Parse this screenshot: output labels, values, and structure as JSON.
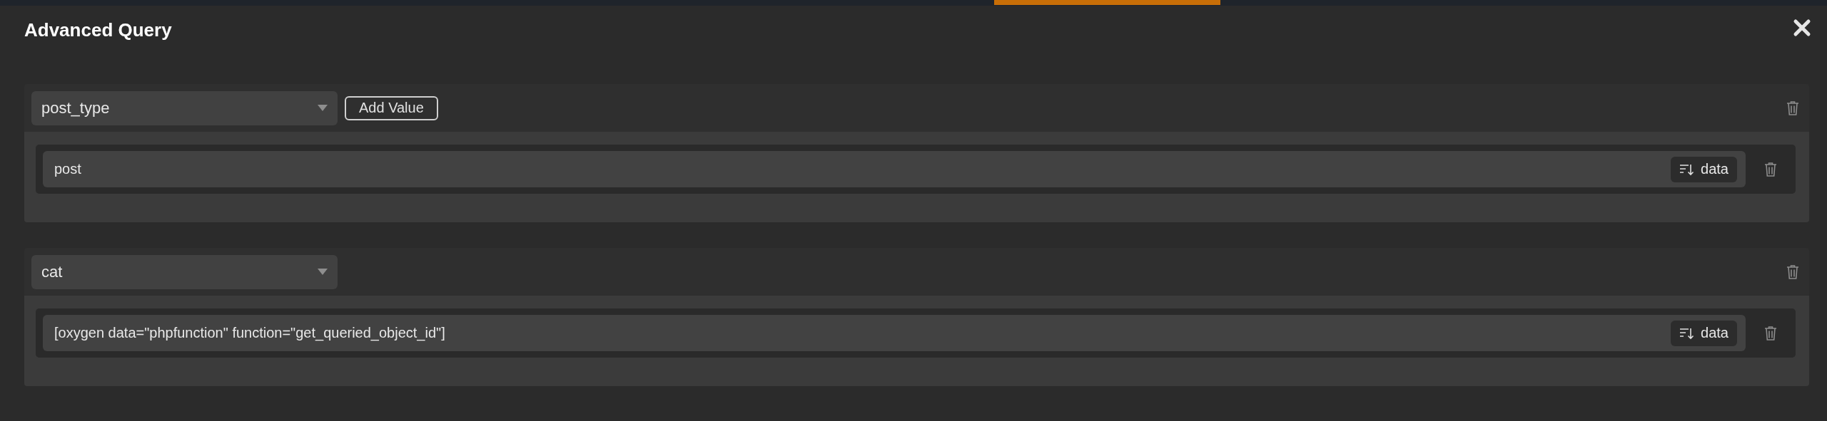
{
  "title": "Advanced Query",
  "groups": [
    {
      "key": "post_type",
      "add_button": "Add Value",
      "values": [
        {
          "text": "post",
          "source_button": "data"
        }
      ]
    },
    {
      "key": "cat",
      "values": [
        {
          "text": "[oxygen data=\"phpfunction\" function=\"get_queried_object_id\"]",
          "source_button": "data"
        }
      ]
    }
  ]
}
